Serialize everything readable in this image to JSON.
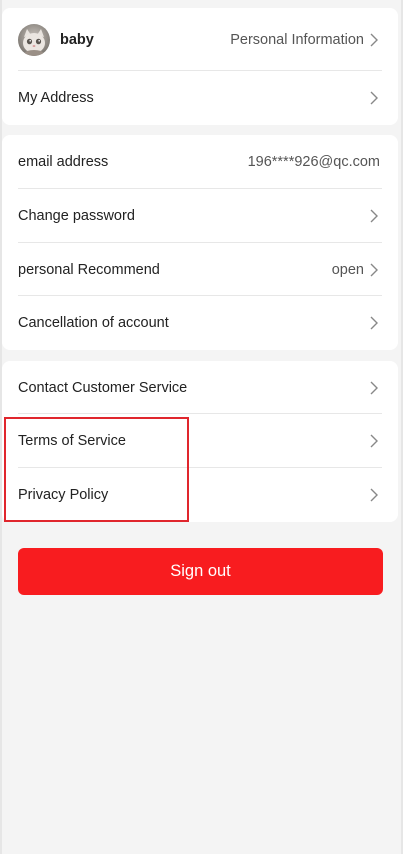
{
  "profile": {
    "username": "baby",
    "personal_info_label": "Personal Information",
    "my_address_label": "My Address"
  },
  "account": {
    "email_label": "email address",
    "email_value": "196****926@qc.com",
    "change_password_label": "Change password",
    "recommend_label": "personal Recommend",
    "recommend_value": "open",
    "cancellation_label": "Cancellation of account"
  },
  "support": {
    "contact_label": "Contact Customer Service",
    "terms_label": "Terms of Service",
    "privacy_label": "Privacy Policy"
  },
  "actions": {
    "sign_out_label": "Sign out"
  },
  "colors": {
    "accent": "#f81c1f",
    "highlight_box": "#e0262d",
    "page_background": "#f4f4f4"
  },
  "icons": [
    "avatar-cat-image",
    "chevron-right-icon"
  ]
}
